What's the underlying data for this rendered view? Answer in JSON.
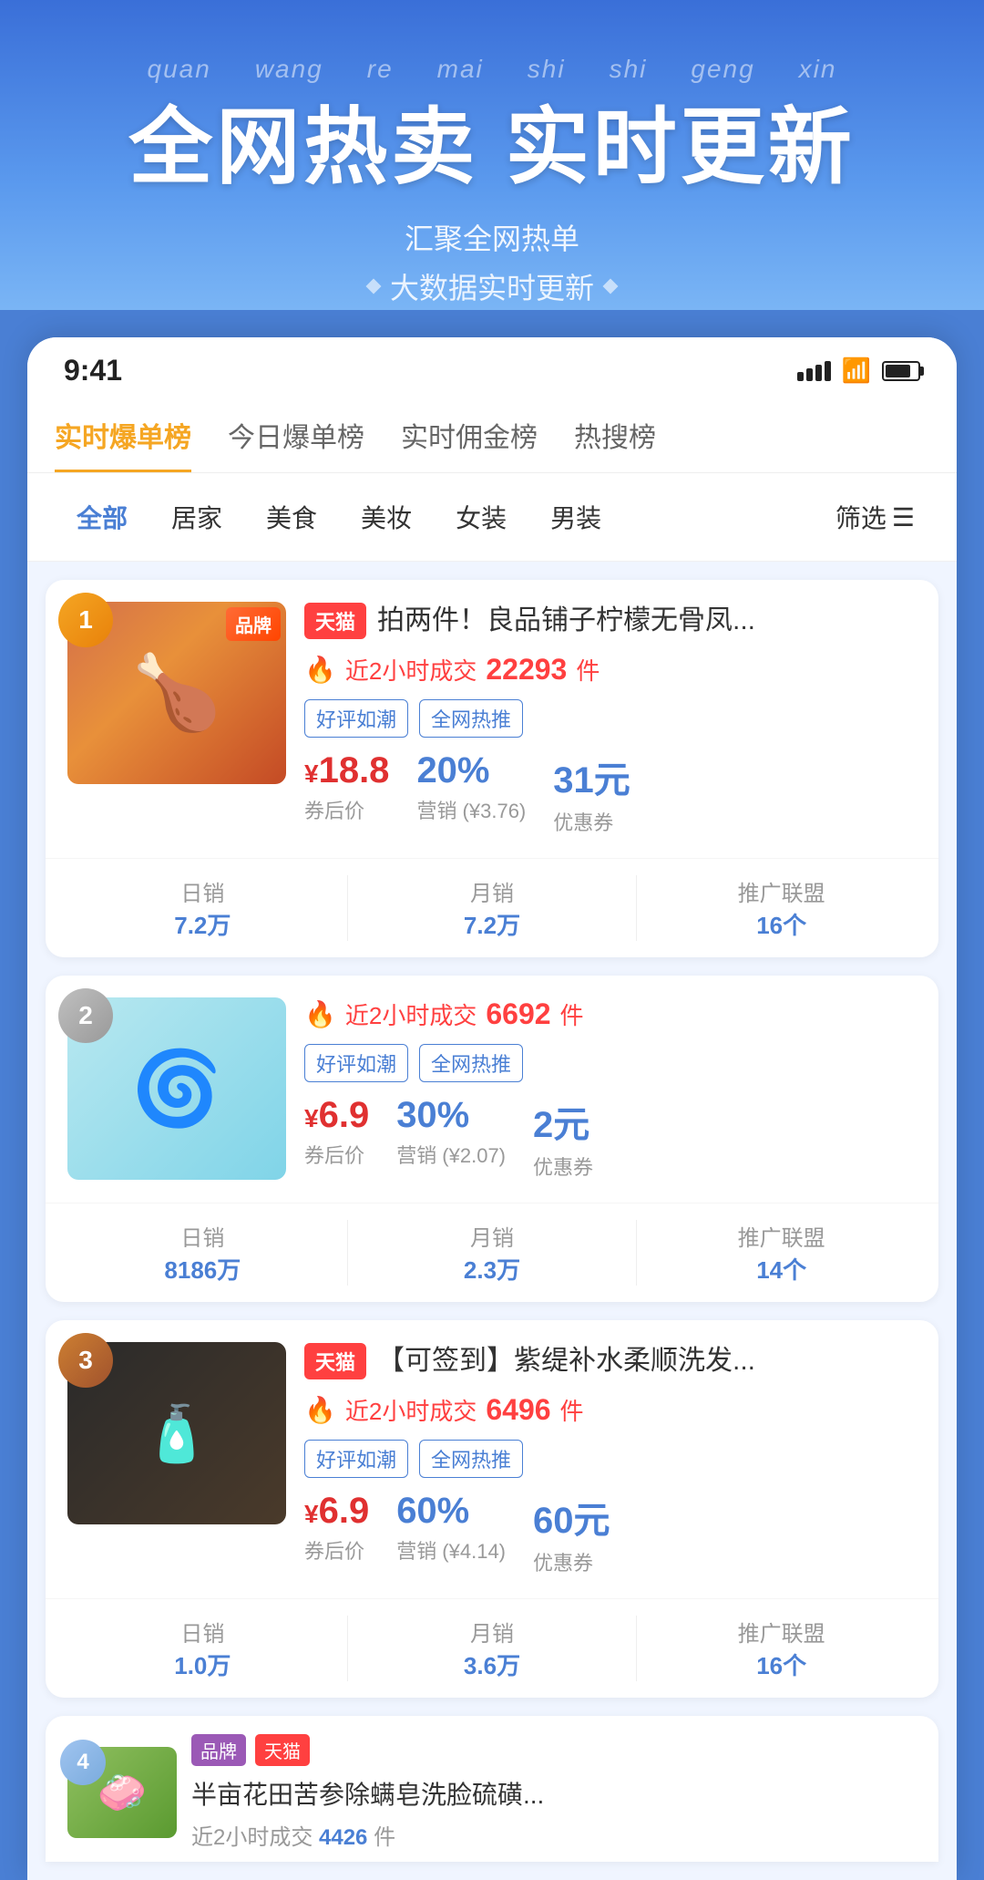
{
  "hero": {
    "pinyin": [
      "quan",
      "wang",
      "re",
      "mai",
      "shi",
      "shi",
      "geng",
      "xin"
    ],
    "title": "全网热卖 实时更新",
    "subtitle1": "汇聚全网热单",
    "subtitle2": "大数据实时更新"
  },
  "statusBar": {
    "time": "9:41"
  },
  "tabs": [
    {
      "id": "realtime",
      "label": "实时爆单榜",
      "active": true
    },
    {
      "id": "today",
      "label": "今日爆单榜",
      "active": false
    },
    {
      "id": "commission",
      "label": "实时佣金榜",
      "active": false
    },
    {
      "id": "hot",
      "label": "热搜榜",
      "active": false
    }
  ],
  "categories": [
    {
      "id": "all",
      "label": "全部",
      "active": true
    },
    {
      "id": "home",
      "label": "居家",
      "active": false
    },
    {
      "id": "food",
      "label": "美食",
      "active": false
    },
    {
      "id": "beauty",
      "label": "美妆",
      "active": false
    },
    {
      "id": "women",
      "label": "女装",
      "active": false
    },
    {
      "id": "men",
      "label": "男装",
      "active": false
    }
  ],
  "filterLabel": "筛选",
  "products": [
    {
      "rank": 1,
      "rankClass": "rank-1",
      "hasBrandTag": true,
      "brandTagLabel": "品牌",
      "platform": "天猫",
      "name": "拍两件！良品铺子柠檬无骨凤...",
      "salesHot": "近2小时成交",
      "salesCount": "22293",
      "salesUnit": "件",
      "tags": [
        "好评如潮",
        "全网热推"
      ],
      "price": "18.8",
      "priceLabel": "券后价",
      "pct": "20%",
      "pctSub": "营销 (¥3.76)",
      "coupon": "31元",
      "couponSub": "优惠券",
      "dailySales": "7.2万",
      "monthlySales": "7.2万",
      "alliance": "16个",
      "imgType": "food"
    },
    {
      "rank": 2,
      "rankClass": "rank-2",
      "hasBrandTag": false,
      "brandTagLabel": "",
      "platform": "",
      "name": "",
      "salesHot": "近2小时成交",
      "salesCount": "6692",
      "salesUnit": "件",
      "tags": [
        "好评如潮",
        "全网热推"
      ],
      "price": "6.9",
      "priceLabel": "券后价",
      "pct": "30%",
      "pctSub": "营销 (¥2.07)",
      "coupon": "2元",
      "couponSub": "优惠券",
      "dailySales": "8186万",
      "monthlySales": "2.3万",
      "alliance": "14个",
      "imgType": "fan"
    },
    {
      "rank": 3,
      "rankClass": "rank-3",
      "hasBrandTag": false,
      "brandTagLabel": "",
      "platform": "天猫",
      "name": "【可签到】紫缇补水柔顺洗发...",
      "salesHot": "近2小时成交",
      "salesCount": "6496",
      "salesUnit": "件",
      "tags": [
        "好评如潮",
        "全网热推"
      ],
      "price": "6.9",
      "priceLabel": "券后价",
      "pct": "60%",
      "pctSub": "营销 (¥4.14)",
      "coupon": "60元",
      "couponSub": "优惠券",
      "dailySales": "1.0万",
      "monthlySales": "3.6万",
      "alliance": "16个",
      "imgType": "shampoo"
    },
    {
      "rank": 4,
      "rankClass": "rank-4",
      "hasBrandTag": true,
      "brandTagLabel": "品牌",
      "platform": "天猫",
      "name": "半亩花田苦参除螨皂洗脸硫磺...",
      "salesCount": "4426",
      "imgType": "soap"
    }
  ]
}
